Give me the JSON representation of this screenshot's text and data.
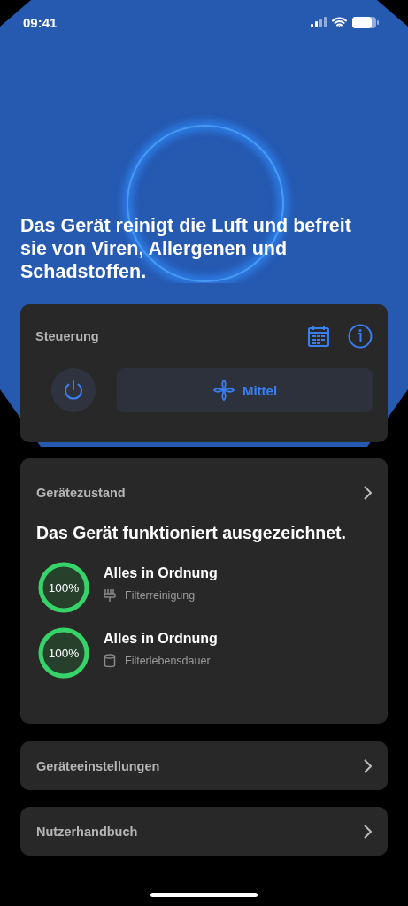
{
  "status_bar": {
    "time": "09:41"
  },
  "headline": "Das Gerät reinigt die Luft und befreit sie von Viren, Allergenen und Schadstoffen.",
  "control_card": {
    "title": "Steuerung",
    "power": {
      "on": false
    },
    "fan_mode": {
      "label": "Mittel"
    }
  },
  "health_card": {
    "title": "Gerätezustand",
    "summary": "Das Gerät funktioniert ausgezeichnet.",
    "items": [
      {
        "level": 1,
        "reading": "100%",
        "status": "Alles in Ordnung",
        "label": "Filterreinigung",
        "kind": "brush"
      },
      {
        "level": 1,
        "reading": "100%",
        "status": "Alles in Ordnung",
        "label": "Filterlebensdauer",
        "kind": "cylinder"
      }
    ]
  },
  "links": [
    {
      "label": "Geräteeinstellungen"
    },
    {
      "label": "Nutzerhandbuch"
    }
  ]
}
